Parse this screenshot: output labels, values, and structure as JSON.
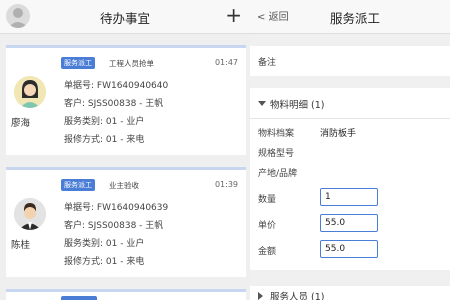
{
  "left": {
    "title": "待办事宜",
    "add_glyph": "+",
    "cards": [
      {
        "name": "廖海",
        "badge": "服务派工",
        "type": "工程人员抢单",
        "time": "01:47",
        "order": "单据号: FW1640940640",
        "customer": "客户: SJSS00838 - 王帆",
        "category": "服务类别: 01 - 业户",
        "report": "报修方式: 01 - 来电"
      },
      {
        "name": "陈桂",
        "badge": "服务派工",
        "type": "业主验收",
        "time": "01:39",
        "order": "单据号: FW1640940639",
        "customer": "客户: SJSS00838 - 王帆",
        "category": "服务类别: 01 - 业户",
        "report": "报修方式: 01 - 来电"
      }
    ]
  },
  "right": {
    "back": "返回",
    "title": "服务派工",
    "remark_label": "备注",
    "material_section": "物料明细 (1)",
    "fields": {
      "archive_label": "物料档案",
      "archive_value": "消防板手",
      "spec_label": "规格型号",
      "origin_label": "产地/品牌",
      "qty_label": "数量",
      "qty_value": "1",
      "price_label": "单价",
      "price_value": "55.0",
      "amount_label": "金额",
      "amount_value": "55.0"
    },
    "staff_section": "服务人员 (1)"
  },
  "colors": {
    "accent": "#4a7ed6",
    "card_top": "#c9d6f0"
  },
  "icons": [
    "user-avatar-icon",
    "plus-icon",
    "back-chevron-icon",
    "collapse-triangle-icon",
    "expand-triangle-icon"
  ]
}
